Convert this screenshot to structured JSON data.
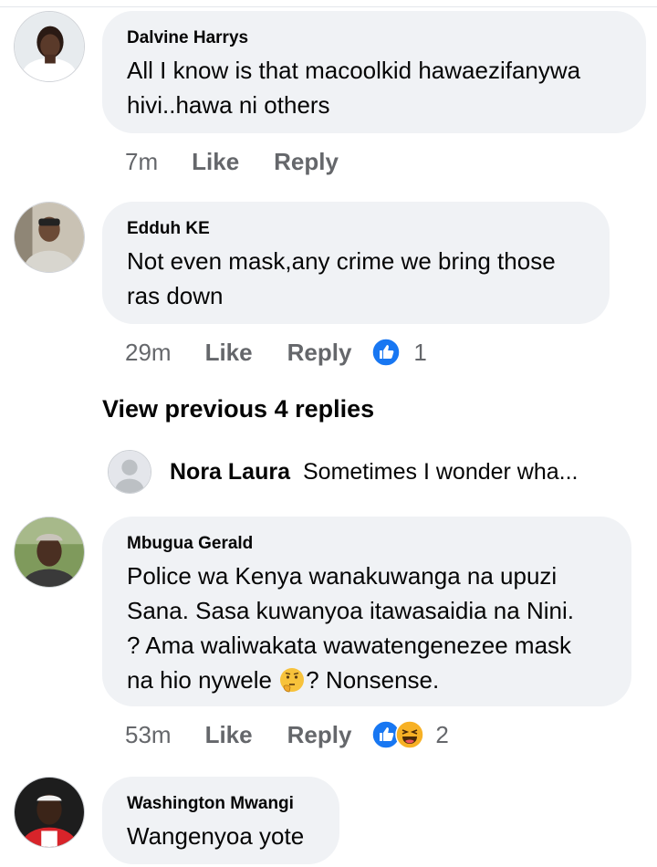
{
  "comments": [
    {
      "author": "Dalvine Harrys",
      "text_lines": [
        "All I know is that macoolkid hawaezifanywa",
        "hivi..hawa ni others"
      ],
      "time": "7m",
      "like_label": "Like",
      "reply_label": "Reply"
    },
    {
      "author": "Edduh KE",
      "text_lines": [
        "Not even mask,any crime we bring those",
        "ras down"
      ],
      "time": "29m",
      "like_label": "Like",
      "reply_label": "Reply",
      "reaction_icons": [
        "like-reaction-icon"
      ],
      "reaction_count": "1"
    },
    {
      "author": "Mbugua Gerald",
      "text_lines": [
        "Police wa Kenya wanakuwanga na upuzi",
        "Sana. Sasa kuwanyoa itawasaidia na Nini.",
        "? Ama waliwakata wawatengenezee mask",
        "na hio nywele",
        "? Nonsense."
      ],
      "inline_emoji": "thinking-face-emoji",
      "time": "53m",
      "like_label": "Like",
      "reply_label": "Reply",
      "reaction_icons": [
        "like-reaction-icon",
        "haha-reaction-icon"
      ],
      "reaction_count": "2"
    },
    {
      "author": "Washington Mwangi",
      "text_lines": [
        "Wangenyoa yote"
      ]
    }
  ],
  "view_previous": "View previous 4 replies",
  "reply_preview": {
    "author": "Nora Laura",
    "snippet": "Sometimes I wonder wha..."
  },
  "colors": {
    "bubble": "#f0f2f5",
    "meta_text": "#65676b",
    "like_blue": "#1877f2",
    "haha_yellow": "#f7b125"
  }
}
